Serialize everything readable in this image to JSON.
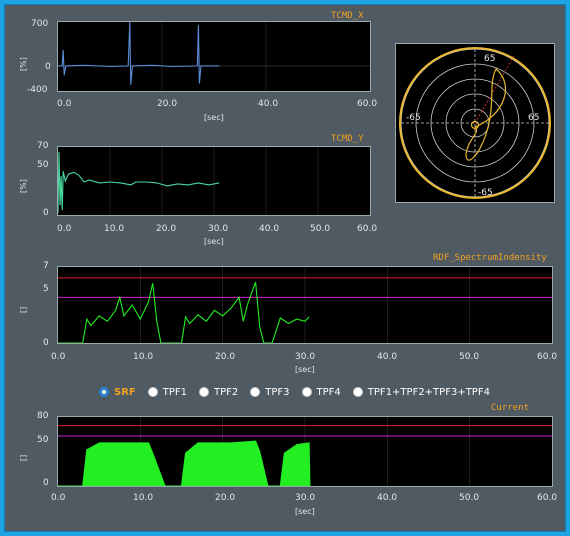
{
  "charts": {
    "tcmd_x": {
      "title": "TCMD_X",
      "ylabel": "[%]",
      "xlabel": "[sec]",
      "y_ticks": [
        "700",
        "0",
        "-400"
      ],
      "x_ticks": [
        "0.0",
        "20.0",
        "40.0",
        "60.0"
      ],
      "color": "#5b8ed8"
    },
    "tcmd_y": {
      "title": "TCMD_Y",
      "ylabel": "[%]",
      "xlabel": "[sec]",
      "y_ticks": [
        "70",
        "50",
        "0"
      ],
      "x_ticks": [
        "0.0",
        "10.0",
        "20.0",
        "30.0",
        "40.0",
        "50.0",
        "60.0"
      ],
      "color": "#4ad8a0"
    },
    "rdf": {
      "title": "RDF_SpectrumIndensity",
      "ylabel": "[]",
      "xlabel": "[sec]",
      "y_ticks": [
        "7",
        "5",
        "0"
      ],
      "x_ticks": [
        "0.0",
        "10.0",
        "20.0",
        "30.0",
        "40.0",
        "50.0",
        "60.0"
      ],
      "color": "#22ee22",
      "limit_upper_color": "#e0202a",
      "limit_lower_color": "#cc22cc"
    },
    "current": {
      "title": "Current",
      "ylabel": "[]",
      "xlabel": "[sec]",
      "y_ticks": [
        "80",
        "50",
        "0"
      ],
      "x_ticks": [
        "0.0",
        "10.0",
        "20.0",
        "30.0",
        "40.0",
        "50.0",
        "60.0"
      ],
      "color": "#22ee22",
      "limit_upper_color": "#e0202a",
      "limit_lower_color": "#cc22cc"
    },
    "polar": {
      "labels": {
        "top": "65",
        "left": "-65",
        "right": "65",
        "bottom": "-65"
      },
      "ring_color": "#e8b830",
      "trace_color": "#e8b830",
      "ref_color": "#cc2a2a"
    }
  },
  "filter_options": [
    {
      "label": "SRF",
      "selected": true
    },
    {
      "label": "TPF1",
      "selected": false
    },
    {
      "label": "TPF2",
      "selected": false
    },
    {
      "label": "TPF3",
      "selected": false
    },
    {
      "label": "TPF4",
      "selected": false
    },
    {
      "label": "TPF1+TPF2+TPF3+TPF4",
      "selected": false
    }
  ],
  "chart_data": [
    {
      "type": "line",
      "title": "TCMD_X",
      "xlabel": "[sec]",
      "ylabel": "[%]",
      "xlim": [
        0,
        60
      ],
      "ylim": [
        -400,
        700
      ],
      "series": [
        {
          "x": [
            0,
            0.8,
            1.0,
            1.2,
            1.5,
            5,
            10,
            13.5,
            13.8,
            14.0,
            14.3,
            18,
            22,
            26.8,
            27.0,
            27.2,
            27.5,
            31
          ],
          "y": [
            0,
            0,
            250,
            -150,
            0,
            10,
            -10,
            0,
            700,
            -300,
            0,
            10,
            -10,
            0,
            650,
            -280,
            0,
            0
          ]
        }
      ]
    },
    {
      "type": "line",
      "title": "TCMD_Y",
      "xlabel": "[sec]",
      "ylabel": "[%]",
      "xlim": [
        0,
        60
      ],
      "ylim": [
        0,
        70
      ],
      "series": [
        {
          "x": [
            0,
            0.2,
            0.4,
            0.6,
            0.8,
            1.0,
            1.4,
            2.0,
            3.0,
            4.0,
            5.0,
            6.0,
            8.0,
            10.0,
            12.0,
            14.0,
            15.0,
            17.0,
            19.0,
            21.0,
            23.0,
            25.0,
            27.0,
            29.0,
            31.0
          ],
          "y": [
            2,
            65,
            10,
            40,
            5,
            45,
            35,
            42,
            44,
            41,
            34,
            36,
            33,
            34,
            33,
            31,
            34,
            34,
            33,
            30,
            32,
            31,
            33,
            31,
            33
          ]
        }
      ]
    },
    {
      "type": "line",
      "title": "RDF_SpectrumIndensity",
      "xlabel": "[sec]",
      "ylabel": "[]",
      "xlim": [
        0,
        60
      ],
      "ylim": [
        0,
        7
      ],
      "series": [
        {
          "x": [
            0,
            3,
            3.5,
            4,
            5,
            6,
            7,
            7.5,
            8,
            9,
            10,
            11,
            11.5,
            12,
            12.5,
            14,
            15,
            15.5,
            16,
            17,
            18,
            19,
            20,
            21,
            22,
            22.5,
            23,
            23.5,
            24,
            24.5,
            25,
            26,
            27,
            28,
            29,
            30,
            30.5
          ],
          "y": [
            0,
            0,
            2.2,
            1.6,
            2.5,
            2.0,
            3.0,
            4.2,
            2.5,
            3.5,
            2.2,
            3.8,
            5.5,
            2.0,
            0,
            0,
            0,
            2.4,
            1.8,
            2.6,
            2.0,
            3.0,
            2.5,
            3.2,
            4.2,
            2.0,
            3.5,
            4.6,
            5.6,
            1.5,
            0,
            0,
            2.3,
            1.8,
            2.2,
            2.0,
            2.4
          ]
        }
      ]
    },
    {
      "type": "area",
      "title": "Current",
      "xlabel": "[sec]",
      "ylabel": "[]",
      "xlim": [
        0,
        60
      ],
      "ylim": [
        0,
        80
      ],
      "series": [
        {
          "x": [
            0,
            3,
            3.5,
            5,
            8,
            11,
            11.5,
            13,
            15,
            15.5,
            17,
            21,
            24,
            24.5,
            25.5,
            27,
            27.5,
            29,
            30.5,
            30.6
          ],
          "y": [
            0,
            0,
            42,
            50,
            50,
            50,
            38,
            0,
            0,
            38,
            50,
            50,
            52,
            40,
            0,
            0,
            38,
            48,
            50,
            0
          ]
        }
      ]
    }
  ]
}
